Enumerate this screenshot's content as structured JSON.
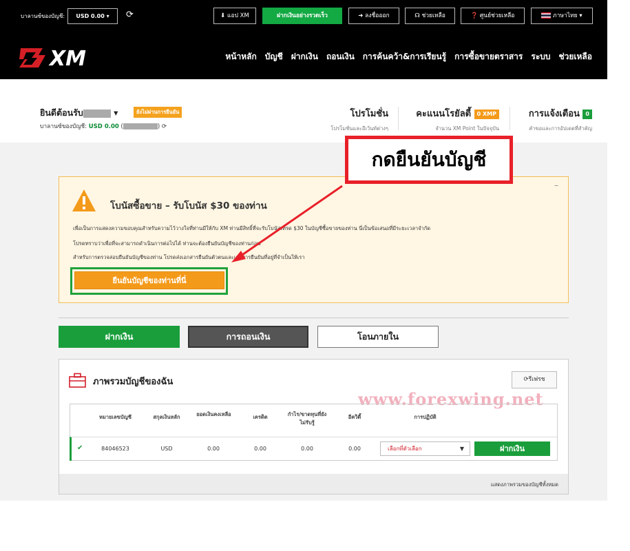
{
  "topbar": {
    "balance_label": "บาลานซ์ของบัญชี:",
    "currency_select": "USD 0.00 ▾",
    "buttons": [
      "แอป XM",
      "ฝากเงินอย่างรวดเร็ว",
      "ลงชื่อออก",
      "ช่วยเหลือ",
      "ศูนย์ช่วยเหลือ",
      "ภาษาไทย"
    ]
  },
  "brand": {
    "logo_text": "XM"
  },
  "nav": [
    "หน้าหลัก",
    "บัญชี",
    "ฝากเงิน",
    "ถอนเงิน",
    "การค้นคว้า&การเรียนรู้",
    "การซื้อขายตราสาร",
    "ระบบ",
    "ช่วยเหลือ"
  ],
  "header": {
    "welcome": "ยินดีต้อนรับ",
    "unverified_badge": "ยังไม่ผ่านการยืนยัน",
    "balance_prefix": "บาลานซ์ของบัญชี:",
    "balance_value": "USD 0.00",
    "promotions_title": "โปรโมชั่น",
    "promotions_sub": "โปรโมชั่นและอีเว้นท์ต่างๆ",
    "loyalty_title": "คะแนนโรยัลตี้",
    "loyalty_badge": "0 XMP",
    "loyalty_sub": "จำนวน XM Point ในปัจจุบัน",
    "notify_title": "การแจ้งเตือน",
    "notify_badge": "0",
    "notify_sub": "คำขอและการอัปเดตที่สำคัญ"
  },
  "callout": {
    "text": "กดยืนยันบัญชี"
  },
  "bonus": {
    "title": "โบนัสซื้อขาย – รับโบนัส $30 ของท่าน",
    "line1": "เพื่อเป็นการแสดงความขอบคุณสำหรับความไว้วางใจที่ท่านมีให้กับ XM ท่านมีสิทธิ์ที่จะรับโบนัสเทรด $30 ในบัญชีซื้อขายของท่าน นี่เป็นข้อเสนอที่มีระยะเวลาจำกัด",
    "line2": "โปรดทราบว่าเพื่อที่จะสามารถดำเนินการต่อไปได้ ท่านจะต้องยืนยันบัญชีของท่านก่อน",
    "line3": "สำหรับการตรวจสอบยืนยันบัญชีของท่าน โปรดส่งเอกสารยืนยันตัวตนและเอกสารยืนยันที่อยู่ที่จำเป็นให้เรา",
    "verify_button": "ยืนยันบัญชีของท่านที่นี่",
    "collapse": "–"
  },
  "tabs": {
    "deposit": "ฝากเงิน",
    "withdraw": "การถอนเงิน",
    "transfer": "โอนภายใน"
  },
  "accounts": {
    "title": "ภาพรวมบัญชีของฉัน",
    "refresh": "รีเฟรช",
    "watermark": "www.forexwing.net",
    "columns": [
      "หมายเลขบัญชี",
      "สกุลเงินหลัก",
      "ยอดเงินคงเหลือ",
      "เครดิต",
      "กำไร/ขาดทุนที่ยังไม่รับรู้",
      "อีควิตี้",
      "การปฏิบัติ"
    ],
    "row": {
      "number": "84046523",
      "currency": "USD",
      "balance": "0.00",
      "credit": "0.00",
      "pnl": "0.00",
      "equity": "0.00",
      "select_placeholder": "เลือกที่ตัวเลือก",
      "deposit_button": "ฝากเงิน"
    },
    "show_all": "แสดงภาพรวมของบัญชีทั้งหมด"
  },
  "colors": {
    "brand_green": "#1a9e3c",
    "accent_orange": "#f49a1a",
    "callout_red": "#e8202a"
  }
}
